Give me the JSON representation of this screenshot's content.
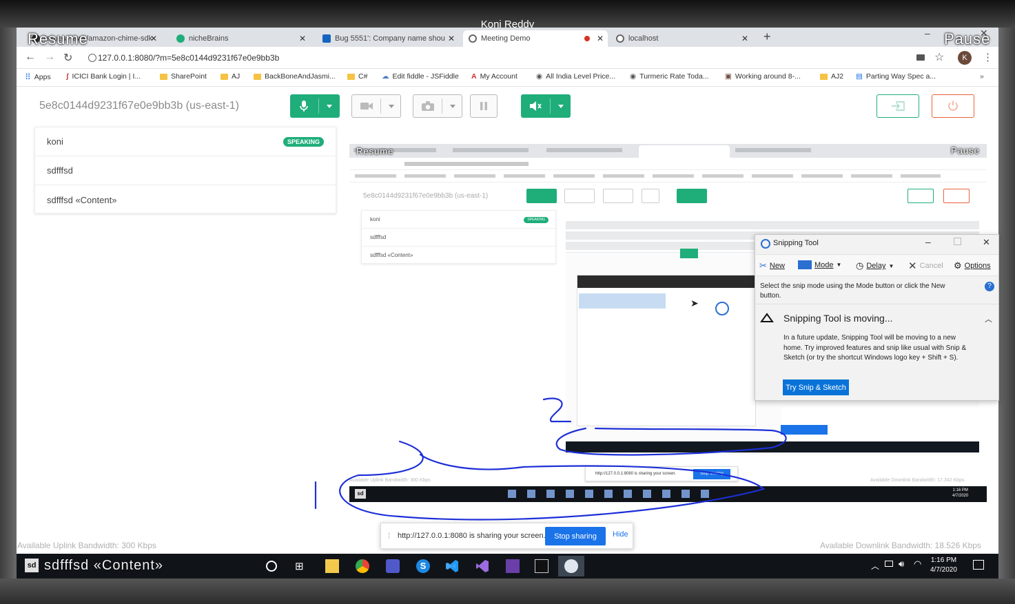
{
  "presenter": "Koni Reddy",
  "overlay": {
    "resume": "Resume",
    "pause": "Pause",
    "nested_resume": "Resume",
    "nested_pause": "Pause"
  },
  "browser": {
    "tabs": [
      {
        "label": "Issues · aws/amazon-chime-sdk-",
        "active": false
      },
      {
        "label": "nicheBrains",
        "active": false
      },
      {
        "label": "Bug 5551': Company name shou",
        "active": false
      },
      {
        "label": "Meeting Demo",
        "active": true
      },
      {
        "label": "localhost",
        "active": false
      }
    ],
    "url": "127.0.0.1:8080/?m=5e8c0144d9231f67e0e9bb3b",
    "avatar_letter": "K",
    "bookmarks": [
      "Apps",
      "ICICI Bank Login | I...",
      "SharePoint",
      "AJ",
      "BackBoneAndJasmi...",
      "C#",
      "Edit fiddle - JSFiddle",
      "My Account",
      "All India Level Price...",
      "Turmeric Rate Toda...",
      "Working around 8-...",
      "AJ2",
      "Parting Way Spec a..."
    ]
  },
  "meeting": {
    "title": "5e8c0144d9231f67e0e9bb3b (us-east-1)",
    "roster": [
      {
        "name": "koni",
        "badge": "SPEAKING"
      },
      {
        "name": "sdfffsd",
        "badge": ""
      },
      {
        "name": "sdfffsd «Content»",
        "badge": ""
      }
    ],
    "uplink": "Available Uplink Bandwidth: 300 Kbps",
    "downlink": "Available Downlink Bandwidth: 18.526 Kbps"
  },
  "share_notice": {
    "text": "http://127.0.0.1:8080 is sharing your screen.",
    "stop_label": "Stop sharing",
    "hide_label": "Hide"
  },
  "taskbar": {
    "search_text": "sdfffsd «Content»",
    "time": "1:16 PM",
    "date": "4/7/2020"
  },
  "nested": {
    "title": "5e8c0144d9231f67e0e9bb3b (us-east-1)",
    "roster": [
      "koni",
      "sdfffsd",
      "sdfffsd «Content»"
    ],
    "badge": "SPEAKING",
    "uplink": "Available Uplink Bandwidth: 300 Kbps",
    "downlink": "Available Downlink Bandwidth: 17.342 Kbps",
    "share_text": "http://127.0.0.1:8080 is sharing your screen.",
    "stop_label": "Stop sharing",
    "time": "1:16 PM",
    "date": "4/7/2020"
  },
  "snipping_tool": {
    "title": "Snipping Tool",
    "toolbar": [
      "New",
      "Mode",
      "Delay",
      "Cancel",
      "Options"
    ],
    "instruction": "Select the snip mode using the Mode button or click the New button.",
    "moving_title": "Snipping Tool is moving...",
    "moving_body": "In a future update, Snipping Tool will be moving to a new home. Try improved features and snip like usual with Snip & Sketch (or try the shortcut Windows logo key + Shift + S).",
    "try_label": "Try Snip & Sketch"
  },
  "annotations": {
    "one": "1",
    "two": "2"
  },
  "colors": {
    "accent_green": "#1fae7a",
    "danger": "#e8623d",
    "link_blue": "#1a73e8",
    "ink": "#1d2fd8"
  }
}
